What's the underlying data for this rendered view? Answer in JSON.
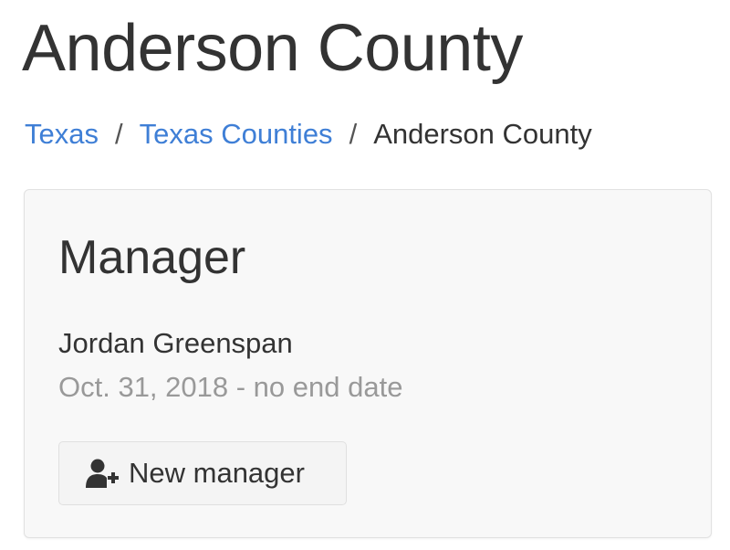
{
  "page": {
    "title": "Anderson County"
  },
  "breadcrumb": {
    "items": [
      {
        "label": "Texas",
        "link": true
      },
      {
        "label": "Texas Counties",
        "link": true
      },
      {
        "label": "Anderson County",
        "link": false
      }
    ],
    "separator": "/"
  },
  "colors": {
    "link": "#3f7fd6",
    "text": "#333333",
    "muted": "#999999",
    "card_bg": "#f8f8f8"
  },
  "manager_card": {
    "heading": "Manager",
    "current_manager": {
      "name": "Jordan Greenspan",
      "dates": "Oct. 31, 2018 - no end date"
    },
    "new_button": {
      "icon": "user-plus-icon",
      "label": "New manager"
    }
  }
}
